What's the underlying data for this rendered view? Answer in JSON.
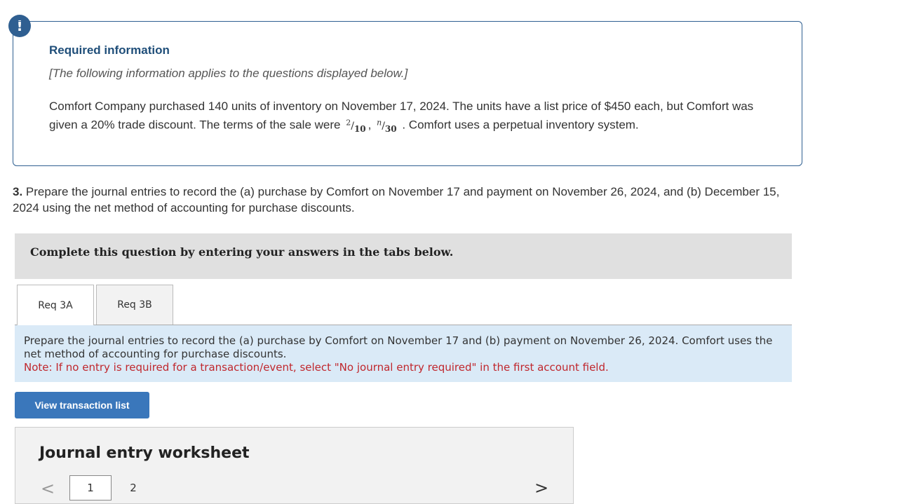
{
  "alert": {
    "icon": "exclamation-icon",
    "symbol": "!"
  },
  "info": {
    "title": "Required information",
    "subtitle": "[The following information applies to the questions displayed below.]",
    "body_part1": "Comfort Company purchased 140 units of inventory on November 17, 2024. The units have a list price of $450 each, but Comfort was given a 20% trade discount. The terms of the sale were",
    "term1_num": "2",
    "term1_den": "10",
    "term2_num": "n",
    "term2_den": "30",
    "body_part2": ". Comfort uses a perpetual inventory system."
  },
  "question": {
    "number": "3.",
    "text": "Prepare the journal entries to record the (a) purchase by Comfort on November 17 and payment on November 26, 2024, and (b) December 15, 2024 using the net method of accounting for purchase discounts."
  },
  "complete_bar": {
    "text": "Complete this question by entering your answers in the tabs below."
  },
  "tabs": [
    {
      "label": "Req 3A",
      "active": true
    },
    {
      "label": "Req 3B",
      "active": false
    }
  ],
  "instructions": {
    "text": "Prepare the journal entries to record the (a) purchase by Comfort on November 17 and (b) payment on November 26, 2024. Comfort uses the net method of accounting for purchase discounts.",
    "note": "Note: If no entry is required for a transaction/event, select \"No journal entry required\" in the first account field."
  },
  "view_button": {
    "label": "View transaction list"
  },
  "worksheet": {
    "title": "Journal entry worksheet",
    "prev_symbol": "<",
    "next_symbol": ">",
    "pages": [
      "1",
      "2"
    ],
    "current_page": "1"
  },
  "colors": {
    "accent": "#2f5f91",
    "button": "#3a77bb",
    "note_red": "#c0272d",
    "instructions_bg": "#daeaf7"
  }
}
